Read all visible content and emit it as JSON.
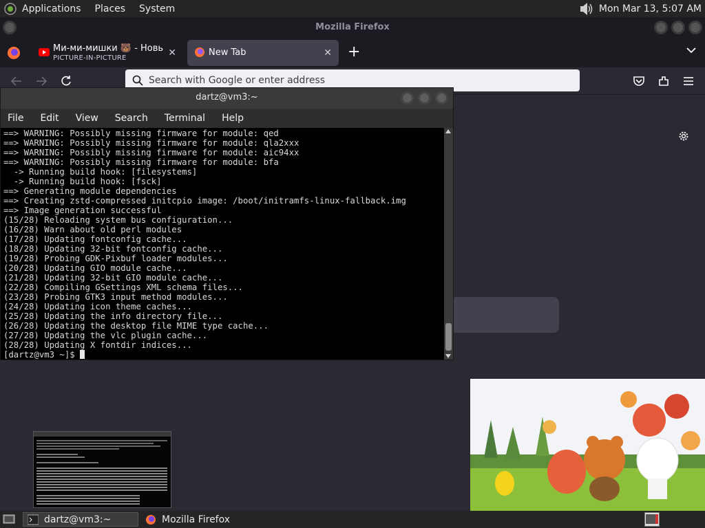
{
  "top_panel": {
    "menus": [
      "Applications",
      "Places",
      "System"
    ],
    "clock": "Mon Mar 13,  5:07 AM",
    "volume_icon": "speaker-icon"
  },
  "firefox": {
    "window_title": "Mozilla Firefox",
    "tabs": [
      {
        "title": "Ми-ми-мишки 🐻 - Новые с",
        "subtitle": "PICTURE-IN-PICTURE",
        "close": "✕"
      },
      {
        "title": "New Tab",
        "close": "✕"
      }
    ],
    "new_tab": "+",
    "url_placeholder": "Search with Google or enter address"
  },
  "terminal": {
    "title": "dartz@vm3:~",
    "menus": [
      "File",
      "Edit",
      "View",
      "Search",
      "Terminal",
      "Help"
    ],
    "lines": [
      "==> WARNING: Possibly missing firmware for module: qed",
      "==> WARNING: Possibly missing firmware for module: qla2xxx",
      "==> WARNING: Possibly missing firmware for module: aic94xx",
      "==> WARNING: Possibly missing firmware for module: bfa",
      "  -> Running build hook: [filesystems]",
      "  -> Running build hook: [fsck]",
      "==> Generating module dependencies",
      "==> Creating zstd-compressed initcpio image: /boot/initramfs-linux-fallback.img",
      "==> Image generation successful",
      "(15/28) Reloading system bus configuration...",
      "(16/28) Warn about old perl modules",
      "(17/28) Updating fontconfig cache...",
      "(18/28) Updating 32-bit fontconfig cache...",
      "(19/28) Probing GDK-Pixbuf loader modules...",
      "(20/28) Updating GIO module cache...",
      "(21/28) Updating 32-bit GIO module cache...",
      "(22/28) Compiling GSettings XML schema files...",
      "(23/28) Probing GTK3 input method modules...",
      "(24/28) Updating icon theme caches...",
      "(25/28) Updating the info directory file...",
      "(26/28) Updating the desktop file MIME type cache...",
      "(27/28) Updating the vlc plugin cache...",
      "(28/28) Updating X fontdir indices..."
    ],
    "prompt": "[dartz@vm3 ~]$ "
  },
  "taskbar": {
    "items": [
      "dartz@vm3:~",
      "Mozilla Firefox"
    ]
  }
}
